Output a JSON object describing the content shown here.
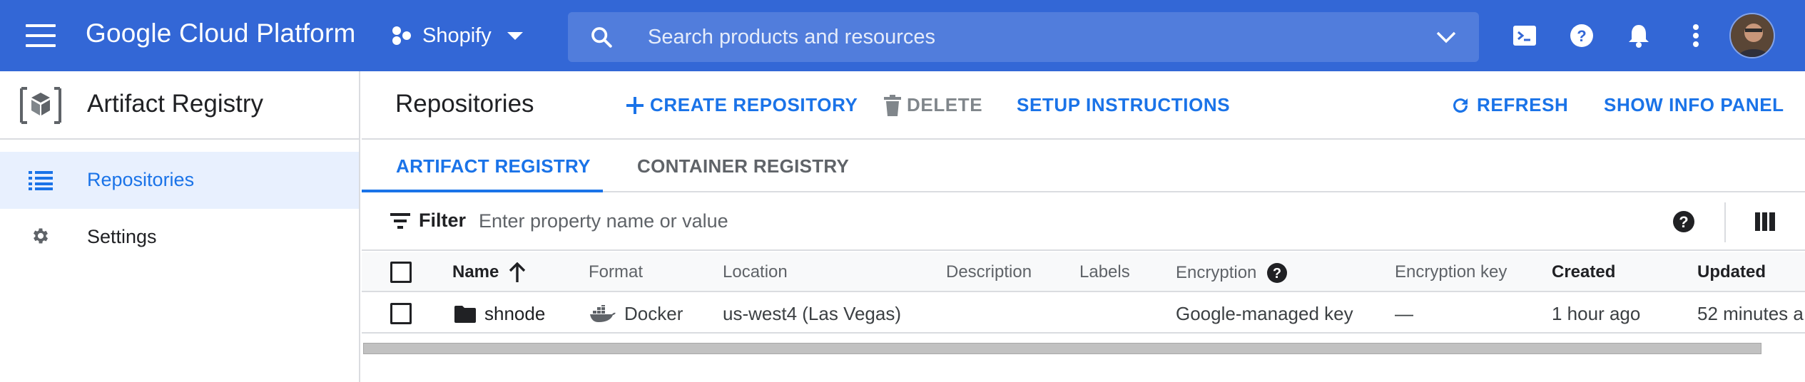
{
  "topbar": {
    "brand": "Google Cloud Platform",
    "project_name": "Shopify",
    "search_placeholder": "Search products and resources",
    "icons": [
      "menu-icon",
      "cloud-shell-icon",
      "help-icon",
      "notifications-icon",
      "more-vert-icon"
    ]
  },
  "sidebar": {
    "product_title": "Artifact Registry",
    "items": [
      {
        "label": "Repositories",
        "icon": "list-icon",
        "active": true
      },
      {
        "label": "Settings",
        "icon": "gear-icon",
        "active": false
      }
    ]
  },
  "toolbar": {
    "page_title": "Repositories",
    "create_label": "CREATE REPOSITORY",
    "delete_label": "DELETE",
    "setup_label": "SETUP INSTRUCTIONS",
    "refresh_label": "REFRESH",
    "info_panel_label": "SHOW INFO PANEL"
  },
  "tabs": [
    {
      "label": "ARTIFACT REGISTRY",
      "active": true
    },
    {
      "label": "CONTAINER REGISTRY",
      "active": false
    }
  ],
  "filter": {
    "label": "Filter",
    "placeholder": "Enter property name or value"
  },
  "table": {
    "columns": [
      "Name",
      "Format",
      "Location",
      "Description",
      "Labels",
      "Encryption",
      "Encryption key",
      "Created",
      "Updated"
    ],
    "rows": [
      {
        "name": "shnode",
        "format": "Docker",
        "location": "us-west4 (Las Vegas)",
        "description": "",
        "labels": "",
        "encryption": "Google-managed key",
        "encryption_key": "—",
        "created": "1 hour ago",
        "updated": "52 minutes a"
      }
    ]
  },
  "colors": {
    "header_bg": "#3367d6",
    "accent": "#1a73e8",
    "active_nav_bg": "#e8f0fe"
  }
}
